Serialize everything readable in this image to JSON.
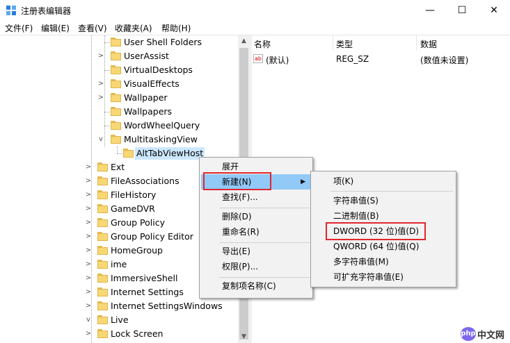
{
  "window": {
    "title": "注册表编辑器",
    "controls": {
      "minimize": "—",
      "maximize": "☐",
      "close": "✕"
    }
  },
  "menubar": {
    "items": [
      "文件(F)",
      "编辑(E)",
      "查看(V)",
      "收藏夹(A)",
      "帮助(H)"
    ]
  },
  "tree": {
    "nodes": [
      {
        "label": "User Shell Folders",
        "expander": "",
        "level": 2
      },
      {
        "label": "UserAssist",
        "expander": ">",
        "level": 2
      },
      {
        "label": "VirtualDesktops",
        "expander": "",
        "level": 2
      },
      {
        "label": "VisualEffects",
        "expander": ">",
        "level": 2
      },
      {
        "label": "Wallpaper",
        "expander": ">",
        "level": 2
      },
      {
        "label": "Wallpapers",
        "expander": "",
        "level": 2
      },
      {
        "label": "WordWheelQuery",
        "expander": "",
        "level": 2
      },
      {
        "label": "MultitaskingView",
        "expander": "v",
        "level": 2
      },
      {
        "label": "AltTabViewHost",
        "expander": "",
        "level": 3,
        "selected": true
      },
      {
        "label": "Ext",
        "expander": ">",
        "level": 1
      },
      {
        "label": "FileAssociations",
        "expander": ">",
        "level": 1
      },
      {
        "label": "FileHistory",
        "expander": ">",
        "level": 1
      },
      {
        "label": "GameDVR",
        "expander": ">",
        "level": 1
      },
      {
        "label": "Group Policy",
        "expander": ">",
        "level": 1
      },
      {
        "label": "Group Policy Editor",
        "expander": ">",
        "level": 1
      },
      {
        "label": "HomeGroup",
        "expander": ">",
        "level": 1
      },
      {
        "label": "ime",
        "expander": ">",
        "level": 1
      },
      {
        "label": "ImmersiveShell",
        "expander": ">",
        "level": 1
      },
      {
        "label": "Internet Settings",
        "expander": ">",
        "level": 1
      },
      {
        "label": "Internet SettingsWindows",
        "expander": ">",
        "level": 1
      },
      {
        "label": "Live",
        "expander": "v",
        "level": 1
      },
      {
        "label": "Lock Screen",
        "expander": ">",
        "level": 1
      }
    ]
  },
  "values_pane": {
    "columns": [
      "名称",
      "类型",
      "数据"
    ],
    "rows": [
      {
        "icon": "ab",
        "name": "(默认)",
        "type": "REG_SZ",
        "data": "(数值未设置)"
      }
    ]
  },
  "context_menu": {
    "items": [
      "展开",
      "新建(N)",
      "查找(F)...",
      "删除(D)",
      "重命名(R)",
      "导出(E)",
      "权限(P)...",
      "复制项名称(C)"
    ],
    "highlighted": "新建(N)"
  },
  "submenu": {
    "items": [
      "项(K)",
      "字符串值(S)",
      "二进制值(B)",
      "DWORD (32 位)值(D)",
      "QWORD (64 位)值(Q)",
      "多字符串值(M)",
      "可扩充字符串值(E)"
    ],
    "highlighted_by_box": "DWORD (32 位)值(D)"
  },
  "watermark": {
    "logo": "php",
    "text": "中文网"
  },
  "colors": {
    "highlight": "#91c9f7",
    "annotation_box": "#e0262c",
    "folder": "#f8d775"
  }
}
